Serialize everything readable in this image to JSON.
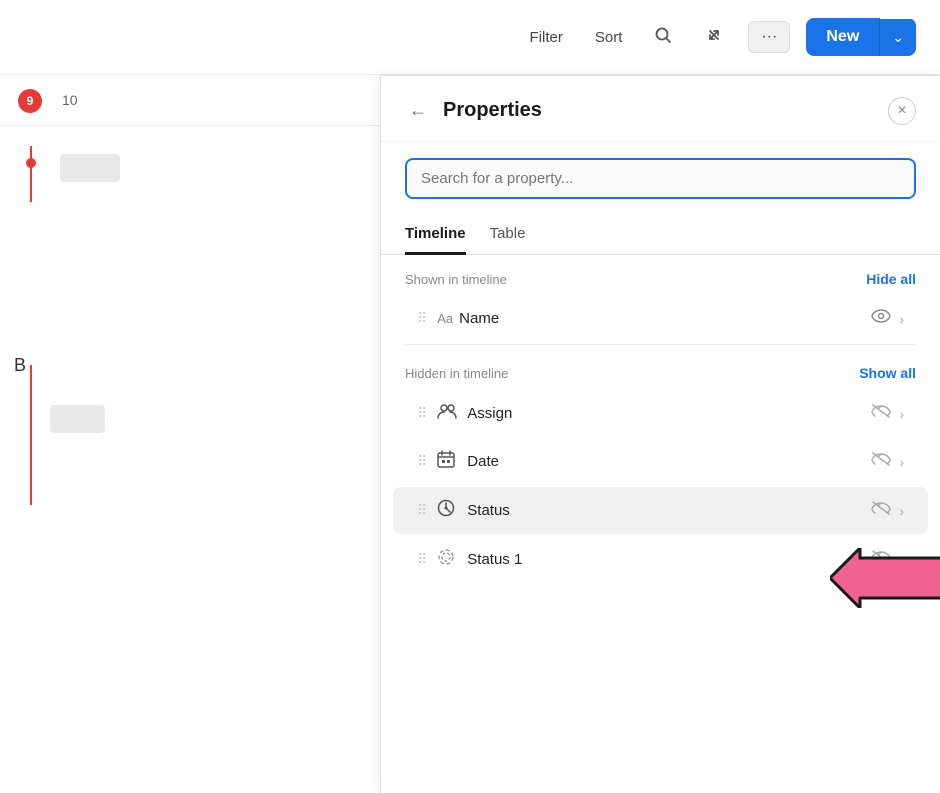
{
  "toolbar": {
    "filter_label": "Filter",
    "sort_label": "Sort",
    "more_label": "···",
    "new_label": "New",
    "new_chevron": "⌄"
  },
  "panel": {
    "title": "Properties",
    "back_icon": "←",
    "close_icon": "×",
    "search_placeholder": "Search for a property...",
    "tabs": [
      {
        "id": "timeline",
        "label": "Timeline",
        "active": true
      },
      {
        "id": "table",
        "label": "Table",
        "active": false
      }
    ],
    "shown_section": {
      "label": "Shown in timeline",
      "action": "Hide all"
    },
    "hidden_section": {
      "label": "Hidden in timeline",
      "action": "Show all"
    },
    "shown_properties": [
      {
        "type_icon": "Aa",
        "name": "Name",
        "visible": true
      }
    ],
    "hidden_properties": [
      {
        "icon": "👥",
        "name": "Assign",
        "visible": false
      },
      {
        "icon": "📅",
        "name": "Date",
        "visible": false
      },
      {
        "icon": "⊙",
        "name": "Status",
        "visible": false,
        "highlighted": true
      },
      {
        "icon": "✳",
        "name": "Status 1",
        "visible": false
      }
    ]
  },
  "timeline": {
    "badge_number": "9",
    "col_10": "10"
  },
  "colors": {
    "blue_accent": "#1a73e8",
    "red_accent": "#e53935"
  }
}
